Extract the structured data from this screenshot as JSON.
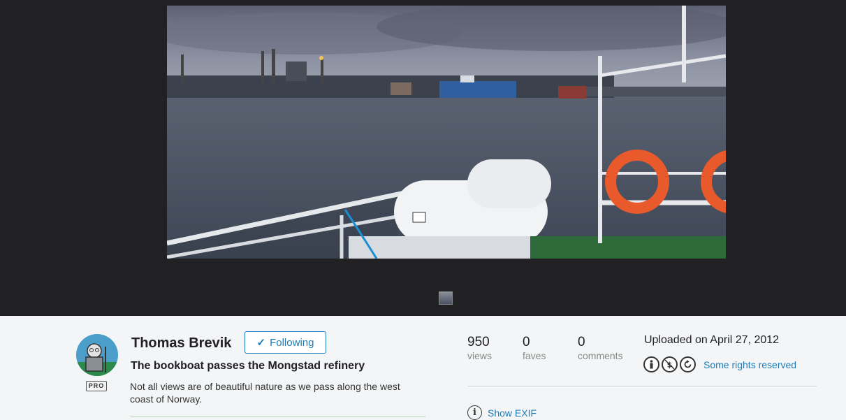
{
  "owner": {
    "name": "Thomas Brevik",
    "badge": "PRO",
    "follow_label": "Following"
  },
  "photo": {
    "title": "The bookboat passes the Mongstad refinery",
    "description": "Not all views are of beautiful nature as we pass along the west coast of Norway."
  },
  "stats": [
    {
      "value": "950",
      "label": "views"
    },
    {
      "value": "0",
      "label": "faves"
    },
    {
      "value": "0",
      "label": "comments"
    }
  ],
  "upload": {
    "text": "Uploaded on April 27, 2012"
  },
  "license": {
    "icons": [
      "attribution-icon",
      "noncommercial-icon",
      "sharealike-icon"
    ],
    "label": "Some rights reserved"
  },
  "exif": {
    "label": "Show EXIF"
  },
  "colors": {
    "viewer_bg": "#212124",
    "link": "#1c7cb8",
    "page_bg": "#f3f5f6"
  }
}
